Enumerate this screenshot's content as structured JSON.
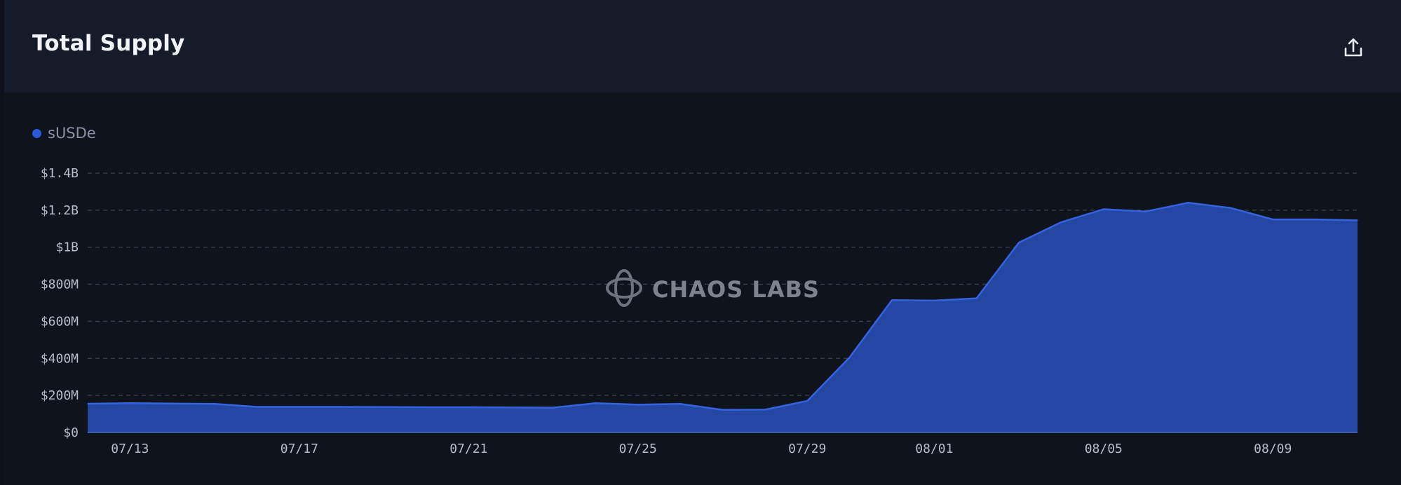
{
  "header": {
    "title": "Total Supply",
    "export_icon": "share-upload-icon"
  },
  "legend": {
    "label": "sUSDe",
    "color": "#2a59d6"
  },
  "watermark": {
    "text": "CHAOS LABS",
    "icon": "chaos-labs-logo-icon"
  },
  "colors": {
    "area_fill": "#2449a8",
    "area_line": "#3563e0",
    "grid": "#3a404c"
  },
  "chart_data": {
    "type": "area",
    "title": "Total Supply",
    "series": [
      {
        "name": "sUSDe",
        "x": [
          "07/12",
          "07/13",
          "07/14",
          "07/15",
          "07/16",
          "07/17",
          "07/18",
          "07/19",
          "07/20",
          "07/21",
          "07/22",
          "07/23",
          "07/24",
          "07/25",
          "07/26",
          "07/27",
          "07/28",
          "07/29",
          "07/30",
          "07/31",
          "08/01",
          "08/02",
          "08/03",
          "08/04",
          "08/05",
          "08/06",
          "08/07",
          "08/08",
          "08/09",
          "08/10",
          "08/11"
        ],
        "values": [
          155,
          158,
          156,
          154,
          138,
          138,
          138,
          137,
          136,
          136,
          135,
          134,
          158,
          150,
          154,
          122,
          123,
          170,
          405,
          714,
          712,
          724,
          1025,
          1135,
          1205,
          1193,
          1240,
          1212,
          1150,
          1150,
          1145
        ]
      }
    ],
    "unit": "$M",
    "x_ticks": [
      "07/13",
      "07/17",
      "07/21",
      "07/25",
      "07/29",
      "08/01",
      "08/05",
      "08/09"
    ],
    "y_ticks": [
      {
        "value": 0,
        "label": "$0"
      },
      {
        "value": 200,
        "label": "$200M"
      },
      {
        "value": 400,
        "label": "$400M"
      },
      {
        "value": 600,
        "label": "$600M"
      },
      {
        "value": 800,
        "label": "$800M"
      },
      {
        "value": 1000,
        "label": "$1B"
      },
      {
        "value": 1200,
        "label": "$1.2B"
      },
      {
        "value": 1400,
        "label": "$1.4B"
      }
    ],
    "ylim": [
      0,
      1400
    ],
    "grid": true,
    "legend_position": "top-left"
  }
}
